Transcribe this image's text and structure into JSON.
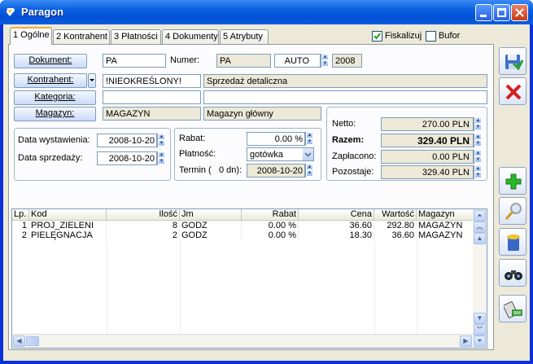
{
  "window": {
    "title": "Paragon"
  },
  "tabs": [
    {
      "label": "1 Ogólne"
    },
    {
      "label": "2 Kontrahent"
    },
    {
      "label": "3 Płatności"
    },
    {
      "label": "4 Dokumenty"
    },
    {
      "label": "5 Atrybuty"
    }
  ],
  "fiscal": {
    "label": "Fiskalizuj",
    "checked": true
  },
  "bufor": {
    "label": "Bufor",
    "checked": false
  },
  "doc": {
    "button": "Dokument:",
    "type": "PA",
    "numer_label": "Numer:",
    "numer_prefix": "PA",
    "numer_auto": "AUTO",
    "numer_year": "2008"
  },
  "kontrahent": {
    "button": "Kontrahent:",
    "code": "!NIEOKREŚLONY!",
    "name": "Sprzedaż detaliczna"
  },
  "kategoria": {
    "button": "Kategoria:",
    "code": "",
    "desc": ""
  },
  "magazyn": {
    "button": "Magazyn:",
    "code": "MAGAZYN",
    "name": "Magazyn główny"
  },
  "dates": {
    "wystawienia_label": "Data wystawienia:",
    "wystawienia": "2008-10-20",
    "sprzedazy_label": "Data sprzedaży:",
    "sprzedazy": "2008-10-20"
  },
  "payment": {
    "rabat_label": "Rabat:",
    "rabat": "0.00 %",
    "platnosc_label": "Płatność:",
    "platnosc": "gotówka",
    "termin_label": "Termin (",
    "termin_days": "0 dn):",
    "termin": "2008-10-20"
  },
  "totals": {
    "netto_label": "Netto:",
    "netto": "270.00 PLN",
    "razem_label": "Razem:",
    "razem": "329.40 PLN",
    "zaplacono_label": "Zapłacono:",
    "zaplacono": "0.00 PLN",
    "pozostaje_label": "Pozostaje:",
    "pozostaje": "329.40 PLN"
  },
  "grid": {
    "headers": [
      "Lp.",
      "Kod",
      "Ilość",
      "Jm",
      "Rabat",
      "Cena",
      "Wartość",
      "Magazyn"
    ],
    "rows": [
      [
        "1",
        "PROJ_ZIELENI",
        "8",
        "GODZ",
        "0.00 %",
        "36.60",
        "292.80",
        "MAGAZYN"
      ],
      [
        "2",
        "PIELĘGNACJA",
        "2",
        "GODZ",
        "0.00 %",
        "18.30",
        "36.60",
        "MAGAZYN"
      ]
    ]
  },
  "sidebar": [
    "save-icon",
    "cancel-icon",
    "add-icon",
    "edit-icon",
    "delete-icon",
    "find-icon",
    "cash-register-icon"
  ]
}
